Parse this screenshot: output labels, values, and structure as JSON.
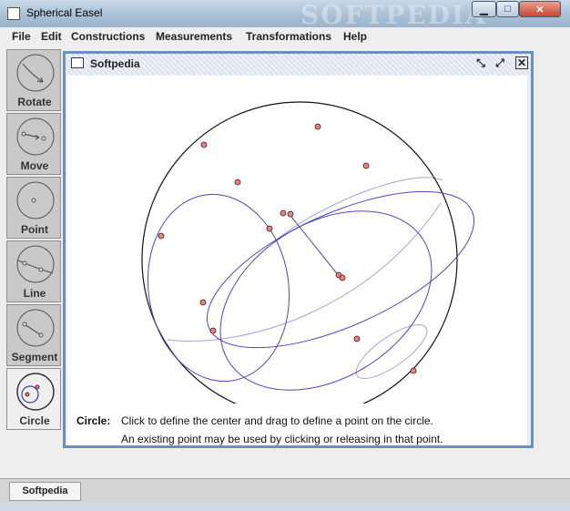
{
  "window": {
    "title": "Spherical Easel",
    "watermark": "SOFTPEDIA",
    "controls": [
      "minimize",
      "maximize",
      "close"
    ]
  },
  "menubar": [
    "File",
    "Edit",
    "Constructions",
    "Measurements",
    "Transformations",
    "Help"
  ],
  "toolbar": {
    "tools": [
      {
        "label": "Rotate",
        "icon": "rotate-icon",
        "selected": false
      },
      {
        "label": "Move",
        "icon": "move-icon",
        "selected": false
      },
      {
        "label": "Point",
        "icon": "point-icon",
        "selected": false
      },
      {
        "label": "Line",
        "icon": "line-icon",
        "selected": false
      },
      {
        "label": "Segment",
        "icon": "segment-icon",
        "selected": false
      },
      {
        "label": "Circle",
        "icon": "circle-icon",
        "selected": true
      }
    ]
  },
  "document": {
    "title": "Softpedia",
    "controls": [
      "iconify-icon",
      "maximize-icon",
      "close-icon"
    ]
  },
  "status": {
    "tool": "Circle:",
    "line1": "Click to define the center and drag to define a point on the circle.",
    "line2": "An existing point may be used by clicking or releasing in that point."
  },
  "taskbar": {
    "items": [
      "Softpedia"
    ]
  },
  "colors": {
    "point_fill": "#f08080",
    "curve": "#4a4ab8",
    "curve_back": "#a0a4dc",
    "frame": "#6c8fc2"
  }
}
